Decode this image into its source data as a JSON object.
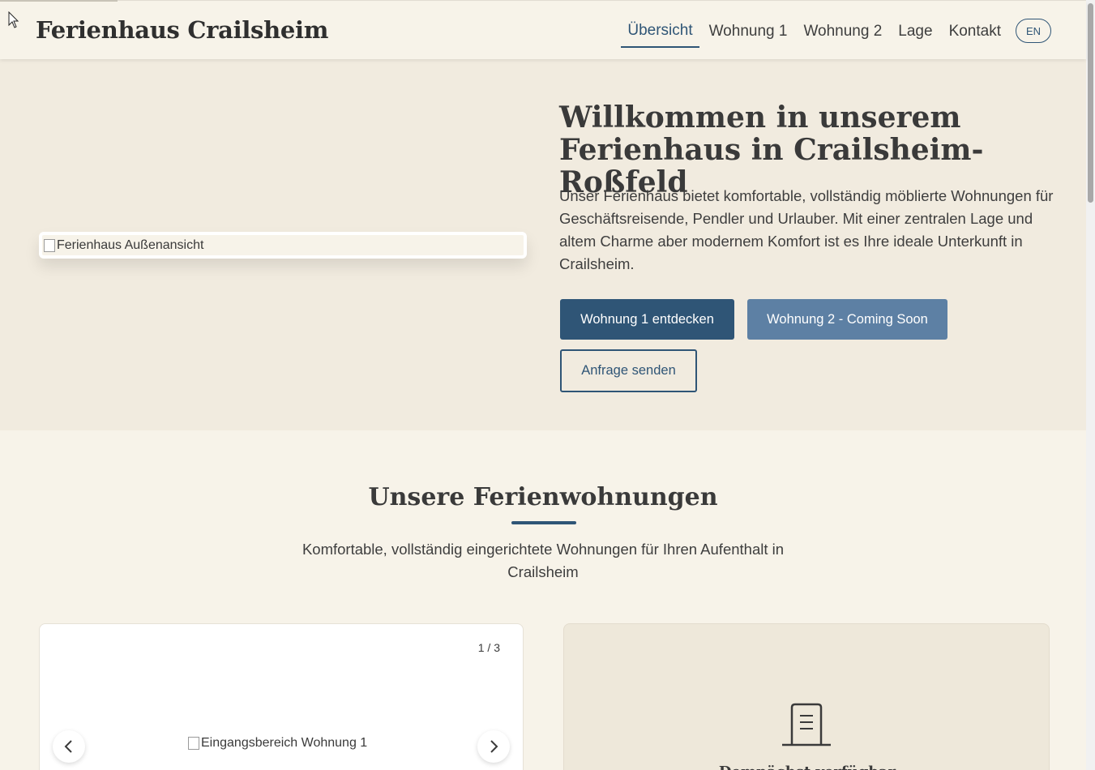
{
  "header": {
    "brand": "Ferienhaus Crailsheim",
    "nav": [
      {
        "label": "Übersicht",
        "active": true
      },
      {
        "label": "Wohnung 1",
        "active": false
      },
      {
        "label": "Wohnung 2",
        "active": false
      },
      {
        "label": "Lage",
        "active": false
      },
      {
        "label": "Kontakt",
        "active": false
      }
    ],
    "lang_button": "EN"
  },
  "hero": {
    "image_alt": "Ferienhaus Außenansicht",
    "title": "Willkommen in unserem Ferienhaus in Crailsheim-Roßfeld",
    "text": "Unser Ferienhaus bietet komfortable, vollständig möblierte Wohnungen für Geschäftsreisende, Pendler und Urlauber. Mit einer zentralen Lage und altem Charme aber modernem Komfort ist es Ihre ideale Unterkunft in Crailsheim.",
    "btn_primary": "Wohnung 1 entdecken",
    "btn_secondary": "Wohnung 2 - Coming Soon",
    "btn_outline": "Anfrage senden"
  },
  "apartments": {
    "title": "Unsere Ferienwohnungen",
    "subtitle": "Komfortable, vollständig eingerichtete Wohnungen für Ihren Aufenthalt in Crailsheim",
    "card1": {
      "counter": "1 / 3",
      "image_alt": "Eingangsbereich Wohnung 1",
      "prev_icon": "chevron-left-icon",
      "next_icon": "chevron-right-icon"
    },
    "card2": {
      "icon": "door-icon",
      "text": "Demnächst verfügbar"
    }
  },
  "colors": {
    "accent": "#2f5576",
    "secondary": "#5d80a4",
    "background": "#f7f3e9",
    "hero_background": "#f1ebdf"
  }
}
